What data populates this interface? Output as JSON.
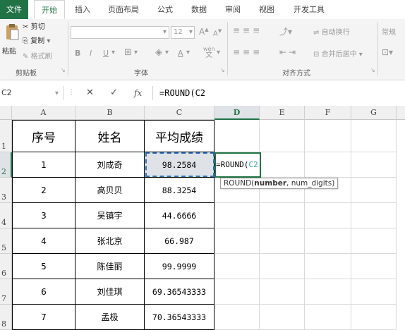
{
  "ribbon_tabs": [
    "文件",
    "开始",
    "插入",
    "页面布局",
    "公式",
    "数据",
    "审阅",
    "视图",
    "开发工具"
  ],
  "clipboard": {
    "paste": "粘贴",
    "cut": "剪切",
    "copy": "复制",
    "format_painter": "格式刷",
    "label": "剪贴板"
  },
  "font": {
    "size": "12",
    "grow": "A",
    "shrink": "A",
    "bold": "B",
    "italic": "I",
    "underline": "U",
    "wen": "wén",
    "label": "字体"
  },
  "alignment": {
    "wrap": "自动换行",
    "merge": "合并后居中",
    "label": "对齐方式"
  },
  "number": {
    "format": "常规"
  },
  "formula_bar": {
    "name_box": "C2",
    "cancel": "✕",
    "enter": "✓",
    "fx": "fx",
    "formula": "=ROUND(C2"
  },
  "columns": [
    "A",
    "B",
    "C",
    "D",
    "E",
    "F",
    "G"
  ],
  "rows": [
    "1",
    "2",
    "3",
    "4",
    "5",
    "6",
    "7",
    "8"
  ],
  "table": {
    "headers": [
      "序号",
      "姓名",
      "平均成绩"
    ],
    "data": [
      [
        "1",
        "刘成奇",
        "98.2584"
      ],
      [
        "2",
        "高贝贝",
        "88.3254"
      ],
      [
        "3",
        "吴镇宇",
        "44.6666"
      ],
      [
        "4",
        "张北京",
        "66.987"
      ],
      [
        "5",
        "陈佳丽",
        "99.9999"
      ],
      [
        "6",
        "刘佳琪",
        "69.36543333"
      ],
      [
        "7",
        "孟极",
        "70.36543333"
      ]
    ]
  },
  "editing_cell": {
    "prefix": "=ROUND(",
    "ref": "C2"
  },
  "tooltip": {
    "func": "ROUND(",
    "arg1": "number",
    "rest": ", num_digits)"
  },
  "colors": {
    "excel_green": "#217346",
    "ref_blue": "#2f6eb5",
    "ref_text": "#39a6a0"
  }
}
